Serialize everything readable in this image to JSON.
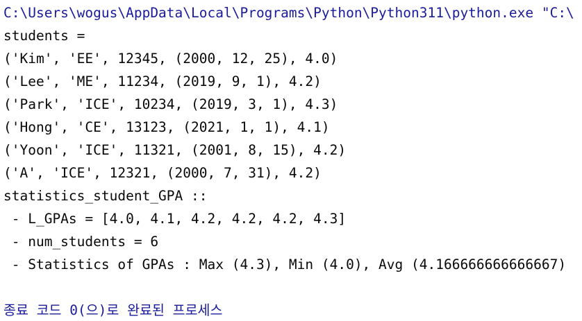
{
  "console": {
    "command_line": "C:\\Users\\wogus\\AppData\\Local\\Programs\\Python\\Python311\\python.exe \"C:\\",
    "output_lines": [
      "students =",
      "('Kim', 'EE', 12345, (2000, 12, 25), 4.0)",
      "('Lee', 'ME', 11234, (2019, 9, 1), 4.2)",
      "('Park', 'ICE', 10234, (2019, 3, 1), 4.3)",
      "('Hong', 'CE', 13123, (2021, 1, 1), 4.1)",
      "('Yoon', 'ICE', 11321, (2001, 8, 15), 4.2)",
      "('A', 'ICE', 12321, (2000, 7, 31), 4.2)",
      "statistics_student_GPA ::",
      " - L_GPAs = [4.0, 4.1, 4.2, 4.2, 4.2, 4.3]",
      " - num_students = 6",
      " - Statistics of GPAs : Max (4.3), Min (4.0), Avg (4.166666666666667)"
    ],
    "exit_message": "종료 코드 0(으)로 완료된 프로세스",
    "colors": {
      "command": "#1a1a9c",
      "output": "#080808",
      "exit": "#1a1a9c",
      "background": "#ffffff"
    }
  }
}
